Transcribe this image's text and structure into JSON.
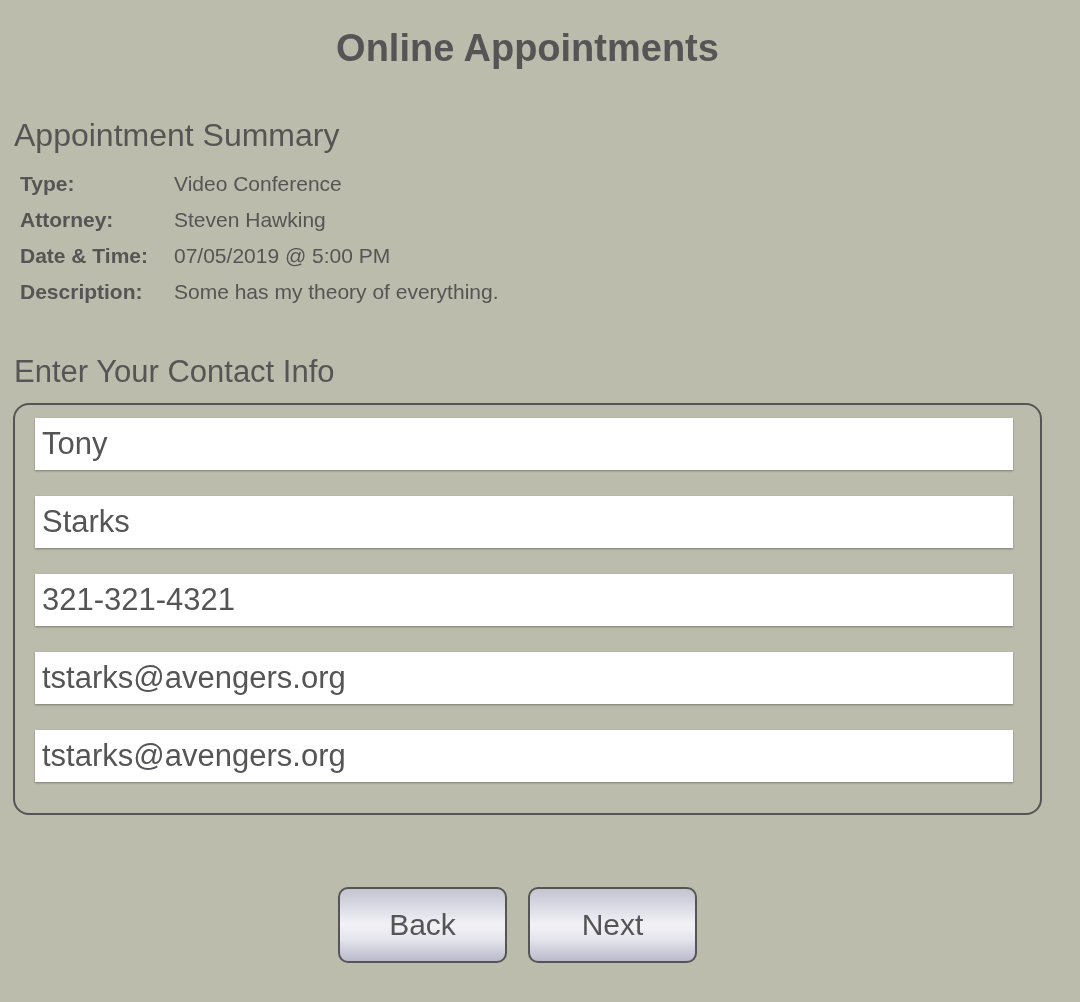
{
  "page": {
    "title": "Online Appointments"
  },
  "summary": {
    "heading": "Appointment Summary",
    "rows": [
      {
        "label": "Type:",
        "value": "Video Conference"
      },
      {
        "label": "Attorney:",
        "value": "Steven Hawking"
      },
      {
        "label": "Date & Time:",
        "value": "07/05/2019 @ 5:00 PM"
      },
      {
        "label": "Description:",
        "value": "Some has my theory of everything."
      }
    ]
  },
  "contact": {
    "heading": "Enter Your Contact Info",
    "fields": [
      {
        "value": "Tony"
      },
      {
        "value": "Starks"
      },
      {
        "value": "321-321-4321"
      },
      {
        "value": "tstarks@avengers.org"
      },
      {
        "value": "tstarks@avengers.org"
      }
    ]
  },
  "buttons": [
    {
      "label": "Back"
    },
    {
      "label": "Next"
    }
  ]
}
